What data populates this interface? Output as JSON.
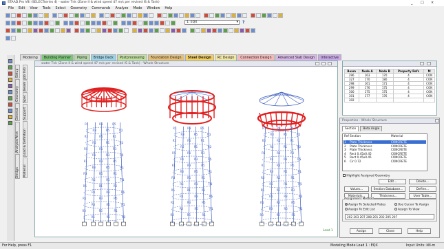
{
  "app": {
    "title": "STAAD.Pro V8i (SELECTseries 4) - water Tnk (Zone II & wind speed 47 m/s per revised IS & Tank)",
    "window_controls": [
      "_",
      "□",
      "×"
    ]
  },
  "menu": [
    "File",
    "Edit",
    "View",
    "Tools",
    "Select",
    "Geometry",
    "Commands",
    "Analyze",
    "Mode",
    "Window",
    "Help"
  ],
  "toolbar": {
    "load_combo": "1: EQX",
    "query": "?"
  },
  "tabs": {
    "modeling": "Modeling",
    "items": [
      {
        "label": "Building Planner",
        "color": "#7cc576"
      },
      {
        "label": "Piping",
        "color": "#b6d7a8"
      },
      {
        "label": "Bridge Deck",
        "color": "#9fd3e6"
      },
      {
        "label": "Postprocessing",
        "color": "#c3e0a0"
      },
      {
        "label": "Foundation Design",
        "color": "#e6c07a"
      },
      {
        "label": "Steel Design",
        "color": "#f0d27a"
      },
      {
        "label": "RC Design",
        "color": "#f1e6a6"
      },
      {
        "label": "Connection Design",
        "color": "#f4b8b8"
      },
      {
        "label": "Advanced Slab Design",
        "color": "#d9b8e8"
      },
      {
        "label": "Interactive",
        "color": "#c9a8e8"
      }
    ],
    "active_index": 5
  },
  "side_tabs": {
    "outer": [
      "Setup",
      "Geometry",
      "General",
      "Analysis/Print",
      "Design"
    ],
    "inner": [
      "Job Info",
      "Beam",
      "Spec",
      "Support",
      "Load & Definition",
      "Material"
    ]
  },
  "viewport": {
    "title": "Whole Structure",
    "title_full": "water Tnk (Zone II & wind speed 47 m/s per revised IS & Tank) - Whole Structure",
    "load_label": "Load 1",
    "member_labels": [
      "R1",
      "R2",
      "R3",
      "R4",
      "R5",
      "R6"
    ]
  },
  "beam_table": {
    "columns": [
      "Beam",
      "Node A",
      "Node B",
      "Property Refs",
      "M"
    ],
    "rows": [
      [
        "296",
        "163",
        "170",
        "4",
        "CON"
      ],
      [
        "327",
        "170",
        "180",
        "4",
        "CON"
      ],
      [
        "298",
        "161",
        "171",
        "4",
        "CON"
      ],
      [
        "299",
        "176",
        "175",
        "4",
        "CON"
      ],
      [
        "300",
        "175",
        "175",
        "4",
        "CON"
      ],
      [
        "301",
        "177",
        "176",
        "4",
        "CON"
      ],
      [
        "302",
        "",
        "",
        "",
        ""
      ]
    ]
  },
  "properties": {
    "title": "Properties - Whole Structure",
    "subtabs": [
      "Section",
      "Beta Angle"
    ],
    "table_headers": [
      "Ref",
      "Section",
      "Material"
    ],
    "rows": [
      [
        "1",
        "Plate Thickness",
        "CONCRETE"
      ],
      [
        "2",
        "Plate Thickness",
        "CONCRETE"
      ],
      [
        "3",
        "Plate Thickness",
        "CONCRETE"
      ],
      [
        "4",
        "Rect 0.45x0.45",
        "CONCRETE"
      ],
      [
        "5",
        "Rect 0.45x0.45",
        "CONCRETE"
      ],
      [
        "6",
        "Cir 0.72",
        "CONCRETE"
      ]
    ],
    "selected_index": 0,
    "highlight_label": "Highlight Assigned Geometry",
    "buttons_row1": [
      "Edit...",
      "Delete..."
    ],
    "buttons_row2": [
      "Values...",
      "Section Database...",
      "Define..."
    ],
    "buttons_row3": [
      "Materials...",
      "Thickness...",
      "User Table..."
    ],
    "assignment_method": "Assignment Method",
    "radio_left": [
      "Assign To Selected Plates",
      "Assign To Edit List"
    ],
    "radio_right": [
      "Use Cursor To Assign",
      "Assign To View"
    ],
    "edit_list": "202 203 207 208 201 202 205 207",
    "bottom_buttons": [
      "Assign",
      "Close",
      "Help"
    ]
  },
  "status": {
    "left": "For Help, press F1",
    "center": "Modeling Mode  Load 1 : EQX",
    "right": "Input Units: kN-m"
  }
}
